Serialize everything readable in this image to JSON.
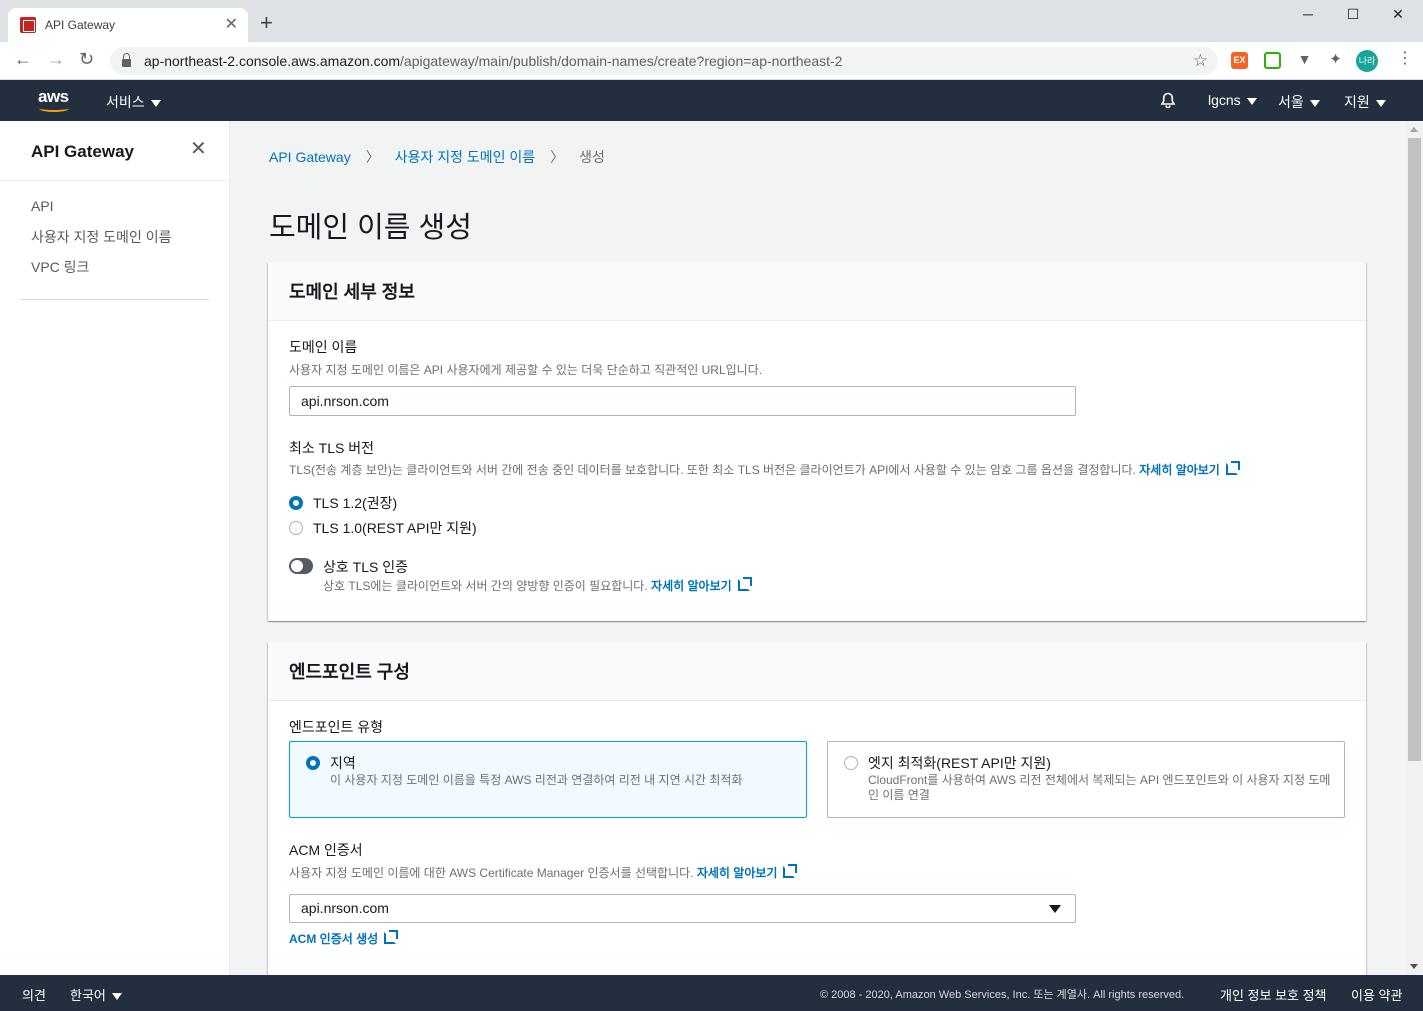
{
  "browser": {
    "tab_title": "API Gateway",
    "new_tab": "+",
    "url_host": "ap-northeast-2.console.aws.amazon.com",
    "url_path": "/apigateway/main/publish/domain-names/create?region=ap-northeast-2",
    "profile_initials": "나라",
    "window_controls": [
      "─",
      "☐",
      "✕"
    ]
  },
  "aws_nav": {
    "logo": "aws",
    "services": "서비스",
    "account": "lgcns",
    "region": "서울",
    "support": "지원"
  },
  "sidebar": {
    "title": "API Gateway",
    "items": [
      {
        "label": "API"
      },
      {
        "label": "사용자 지정 도메인 이름"
      },
      {
        "label": "VPC 링크"
      }
    ]
  },
  "breadcrumb": {
    "items": [
      "API Gateway",
      "사용자 지정 도메인 이름"
    ],
    "current": "생성"
  },
  "page_title": "도메인 이름 생성",
  "domain_details": {
    "heading": "도메인 세부 정보",
    "domain_name_label": "도메인 이름",
    "domain_name_desc": "사용자 지정 도메인 이름은 API 사용자에게 제공할 수 있는 더욱 단순하고 직관적인 URL입니다.",
    "domain_name_value": "api.nrson.com",
    "tls_label": "최소 TLS 버전",
    "tls_desc": "TLS(전송 계층 보안)는 클라이언트와 서버 간에 전송 중인 데이터를 보호합니다. 또한 최소 TLS 버전은 클라이언트가 API에서 사용할 수 있는 암호 그룹 옵션을 결정합니다.",
    "learn_more": "자세히 알아보기",
    "tls_options": [
      {
        "label": "TLS 1.2(권장)",
        "checked": true
      },
      {
        "label": "TLS 1.0(REST API만 지원)",
        "checked": false
      }
    ],
    "mutual_tls_label": "상호 TLS 인증",
    "mutual_tls_desc": "상호 TLS에는 클라이언트와 서버 간의 양방향 인증이 필요합니다.",
    "mutual_tls_enabled": false
  },
  "endpoint_config": {
    "heading": "엔드포인트 구성",
    "type_label": "엔드포인트 유형",
    "options": [
      {
        "title": "지역",
        "desc": "이 사용자 지정 도메인 이름을 특정 AWS 리전과 연결하여 리전 내 지연 시간 최적화",
        "selected": true
      },
      {
        "title": "엣지 최적화(REST API만 지원)",
        "desc": "CloudFront를 사용하여 AWS 리전 전체에서 복제되는 API 엔드포인트와 이 사용자 지정 도메인 이름 연결",
        "selected": false
      }
    ],
    "acm_label": "ACM 인증서",
    "acm_desc": "사용자 지정 도메인 이름에 대한 AWS Certificate Manager 인증서를 선택합니다.",
    "acm_value": "api.nrson.com",
    "acm_create_link": "ACM 인증서 생성"
  },
  "footer": {
    "feedback": "의견",
    "language": "한국어",
    "copyright": "© 2008 - 2020, Amazon Web Services, Inc. 또는 계열사. All rights reserved.",
    "privacy": "개인 정보 보호 정책",
    "terms": "이용 약관"
  },
  "colors": {
    "aws_nav_bg": "#232f3e",
    "link": "#0073bb",
    "selected_tile_border": "#00a1c9",
    "aws_orange": "#ff9900"
  }
}
